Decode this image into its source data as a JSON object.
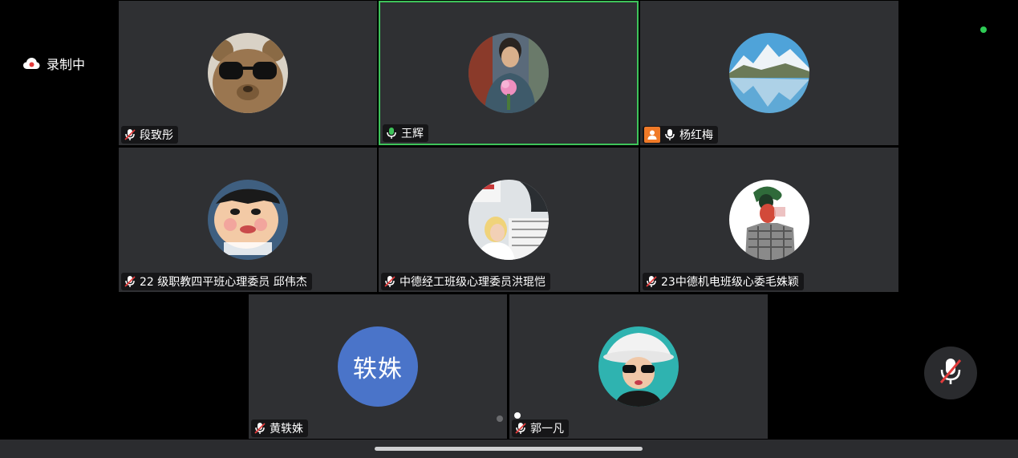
{
  "recording": {
    "label": "录制中",
    "icon": "cloud-icon"
  },
  "participants": [
    {
      "name": "段致彤",
      "mic": "muted",
      "avatar": "bear-sunglasses"
    },
    {
      "name": "王辉",
      "mic": "speaking",
      "avatar": "person-flower",
      "active": true
    },
    {
      "name": "杨红梅",
      "mic": "on",
      "host": true,
      "avatar": "mountain-lake"
    },
    {
      "name": "22 级职教四平班心理委员 邱伟杰",
      "mic": "muted",
      "avatar": "cartoon-boy"
    },
    {
      "name": "中德经工班级心理委员洪琨恺",
      "mic": "muted",
      "avatar": "girl-snow"
    },
    {
      "name": "23中德机电班级心委毛姝颖",
      "mic": "muted",
      "avatar": "art-collage"
    },
    {
      "name": "黄轶姝",
      "mic": "muted",
      "avatar_text": "轶姝"
    },
    {
      "name": "郭一凡",
      "mic": "muted",
      "avatar": "cowboy-hat"
    }
  ],
  "controls": {
    "mute_button_icon": "mic-off-icon"
  },
  "colors": {
    "active_border": "#3ec35a",
    "status_dot": "#2ecc55",
    "host_badge": "#f07a28",
    "initials_avatar": "#4a74c9"
  }
}
